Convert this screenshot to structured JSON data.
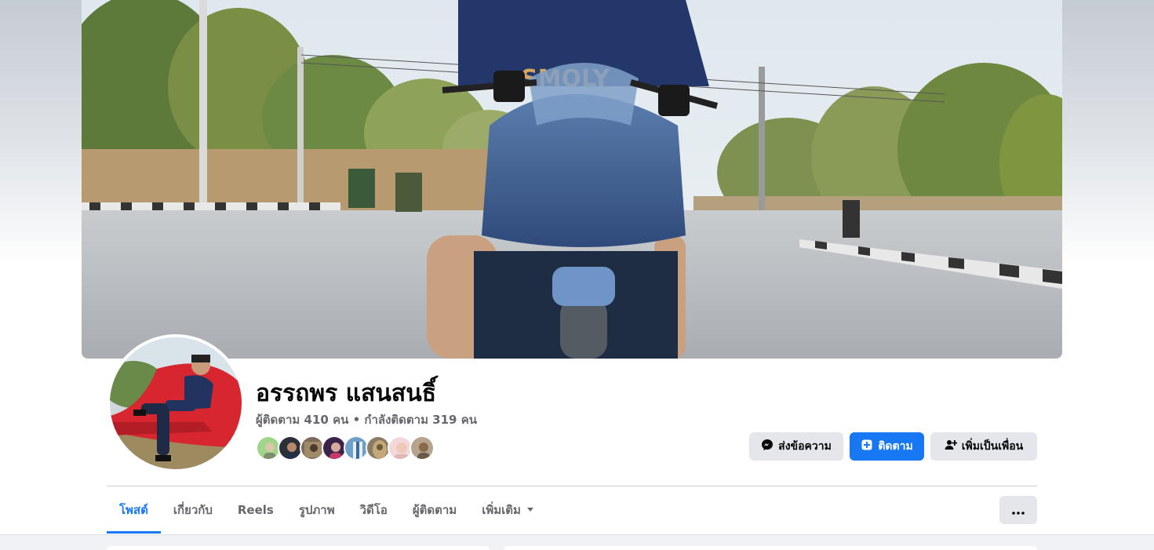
{
  "profile": {
    "name": "อรรถพร แสนสนธิ์",
    "stats": "ผู้ติดตาม 410 คน • กำลังติดตาม 319 คน",
    "friend_avatars": [
      "#9fd68a",
      "#2b2f3a",
      "#7d6a5a",
      "#3a2448",
      "#6e9fc9",
      "#8a7b66",
      "#e3b6b6",
      "#b5a48f"
    ]
  },
  "actions": {
    "message_label": "ส่งข้อความ",
    "follow_label": "ติดตาม",
    "add_friend_label": "เพิ่มเป็นเพื่อน"
  },
  "tabs": [
    {
      "label": "โพสต์",
      "active": true
    },
    {
      "label": "เกี่ยวกับ"
    },
    {
      "label": "Reels"
    },
    {
      "label": "รูปภาพ"
    },
    {
      "label": "วิดีโอ"
    },
    {
      "label": "ผู้ติดตาม"
    },
    {
      "label": "เพิ่มเติม"
    }
  ],
  "icons": {
    "message": "messenger-icon",
    "follow": "follow-plus-icon",
    "add_friend": "add-friend-icon",
    "dropdown": "chevron-down-icon",
    "more": "more-options-icon"
  },
  "colors": {
    "accent": "#1877f2",
    "secondary_button": "#e4e6eb",
    "muted_text": "#65676b"
  }
}
